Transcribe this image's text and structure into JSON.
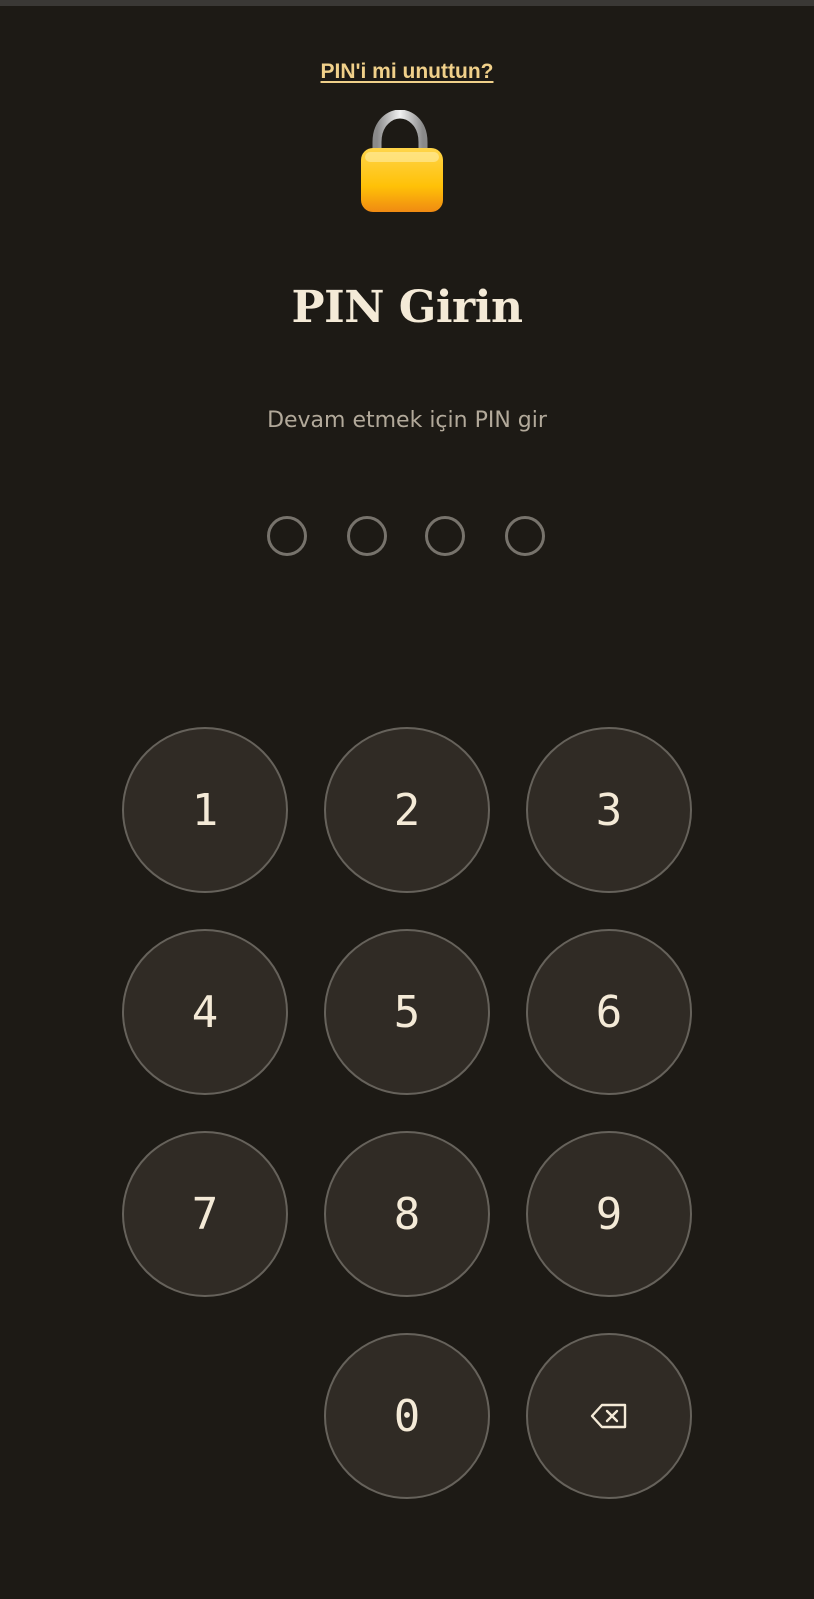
{
  "forgot_link": "PIN'i mi unuttun?",
  "lock_icon": "padlock-icon",
  "title": "PIN Girin",
  "subtitle": "Devam etmek için PIN gir",
  "pin": {
    "length": 4,
    "entered": 0
  },
  "keypad": {
    "keys": [
      "1",
      "2",
      "3",
      "4",
      "5",
      "6",
      "7",
      "8",
      "9",
      "0"
    ],
    "backspace_icon": "backspace-icon"
  },
  "colors": {
    "background": "#1d1a15",
    "key_fill": "#302b25",
    "key_border": "#66625b",
    "text": "#f4ead7",
    "link": "#f0d08a",
    "subtitle": "#b2a99a"
  }
}
